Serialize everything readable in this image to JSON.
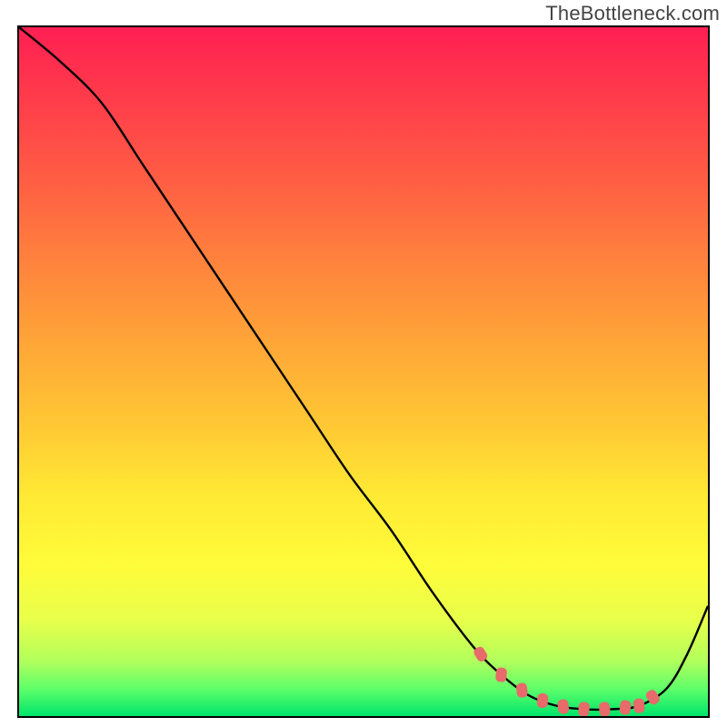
{
  "attribution": "TheBottleneck.com",
  "chart_data": {
    "type": "line",
    "title": "",
    "xlabel": "",
    "ylabel": "",
    "xlim": [
      0,
      100
    ],
    "ylim": [
      0,
      100
    ],
    "grid": false,
    "legend": false,
    "series": [
      {
        "name": "curve",
        "x": [
          0,
          6,
          12,
          18,
          24,
          30,
          36,
          42,
          48,
          54,
          60,
          66,
          70,
          74,
          78,
          82,
          86,
          90,
          94,
          97,
          100
        ],
        "y": [
          100,
          95,
          89,
          80,
          71,
          62,
          53,
          44,
          35,
          27,
          18,
          10,
          6,
          3,
          1.5,
          1,
          1,
          1.5,
          4,
          9,
          16
        ],
        "color": "#000000"
      }
    ],
    "markers": {
      "name": "trough-markers",
      "approx_x_range": [
        67,
        93
      ],
      "approx_y_range": [
        1,
        10
      ],
      "color": "#e86a6a",
      "shape": "rounded-rect",
      "note": "cluster of salmon rounded marks along the valley of the curve"
    },
    "background": {
      "type": "vertical-gradient",
      "stops": [
        {
          "pos": 0.0,
          "color": "#ff1f52"
        },
        {
          "pos": 0.34,
          "color": "#ff823d"
        },
        {
          "pos": 0.68,
          "color": "#ffe934"
        },
        {
          "pos": 0.92,
          "color": "#b2ff5c"
        },
        {
          "pos": 1.0,
          "color": "#00e56b"
        }
      ]
    }
  }
}
